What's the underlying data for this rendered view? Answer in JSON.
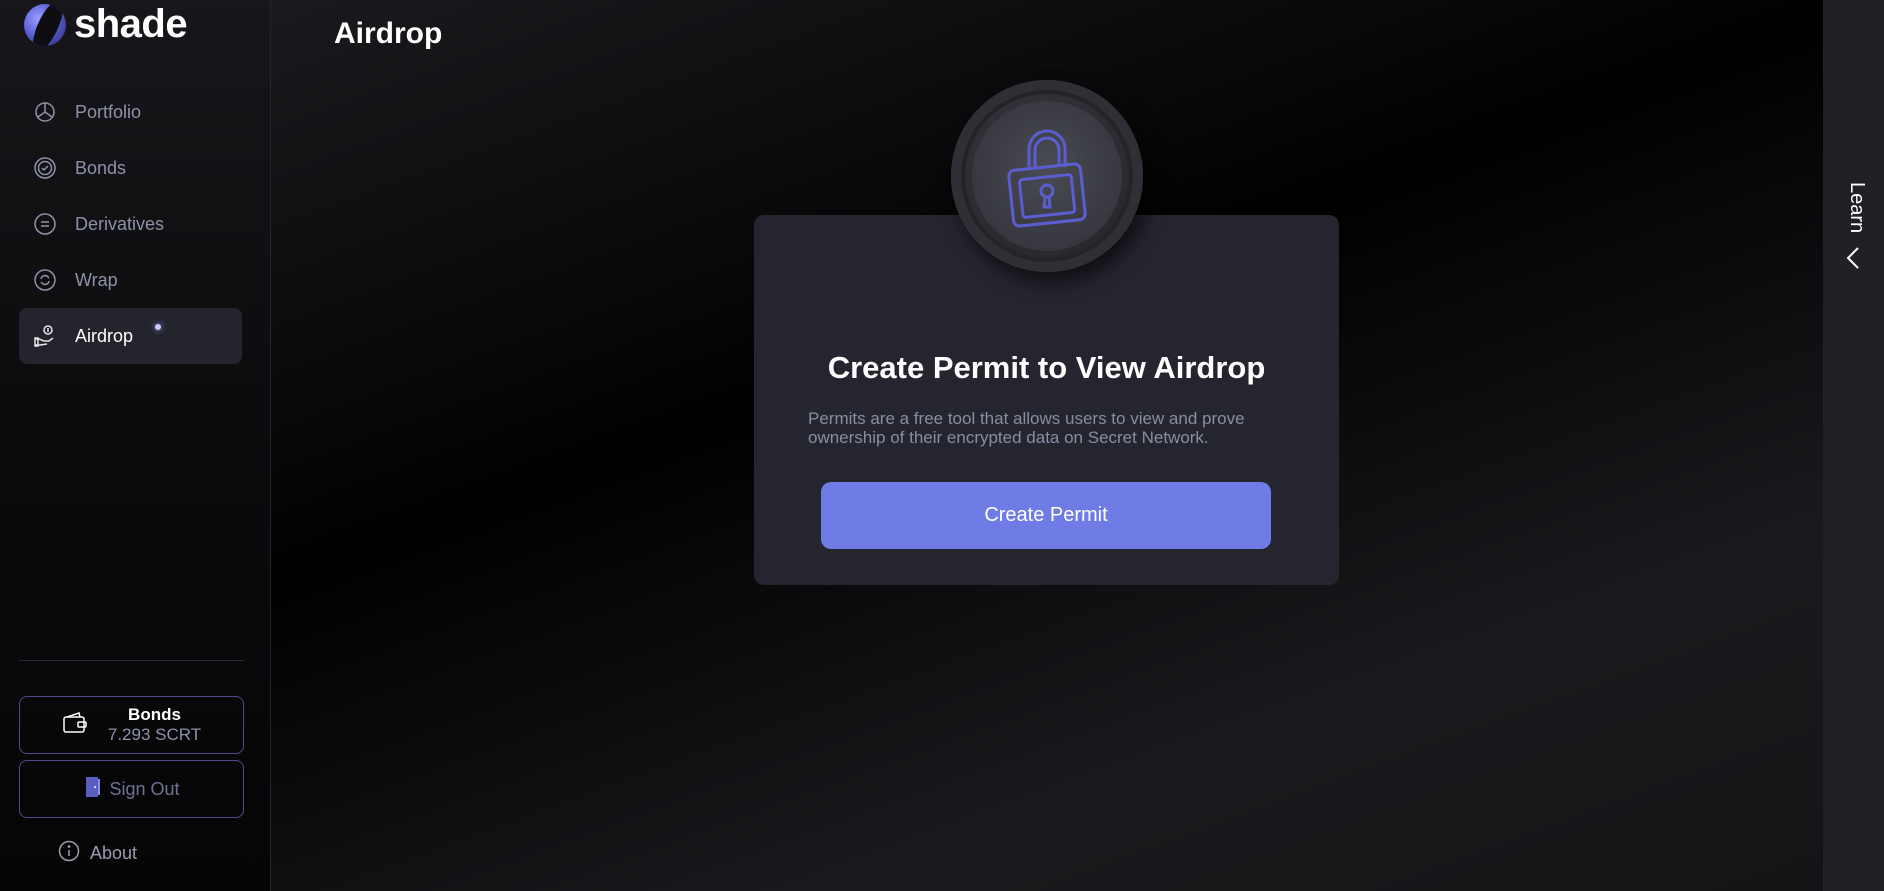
{
  "app": {
    "brand": "shade"
  },
  "sidebar": {
    "items": [
      {
        "label": "Portfolio",
        "icon": "pie-chart-icon"
      },
      {
        "label": "Bonds",
        "icon": "badge-check-icon"
      },
      {
        "label": "Derivatives",
        "icon": "circle-equals-icon"
      },
      {
        "label": "Wrap",
        "icon": "refresh-icon"
      },
      {
        "label": "Airdrop",
        "icon": "hand-coin-icon",
        "active": true
      }
    ],
    "wallet": {
      "title": "Bonds",
      "balance": "7.293 SCRT",
      "icon": "wallet-icon"
    },
    "sign_out": "Sign Out",
    "about": "About"
  },
  "main": {
    "title": "Airdrop",
    "card": {
      "icon": "lock-icon",
      "heading": "Create Permit to View Airdrop",
      "description": "Permits are a free tool that allows users to view and prove ownership of their encrypted data on Secret Network.",
      "button": "Create Permit"
    }
  },
  "learn_panel": {
    "label": "Learn",
    "icon": "chevron-left-icon"
  },
  "colors": {
    "accent": "#6f7ce6",
    "card_bg": "#24252f",
    "muted_text": "#8e92a8",
    "active_nav_bg": "#23242c",
    "border": "#4b4d8a"
  }
}
